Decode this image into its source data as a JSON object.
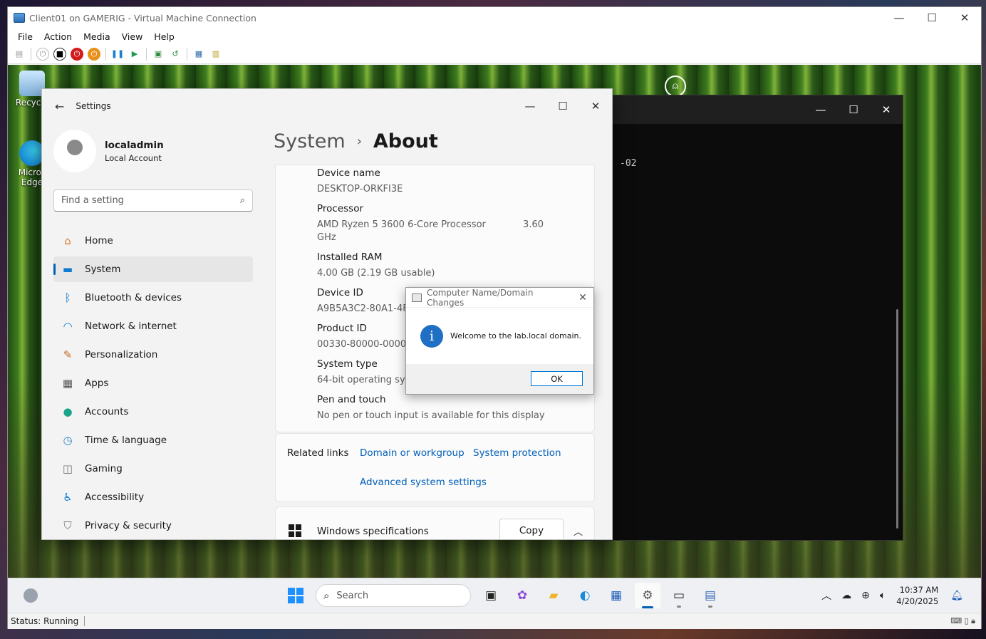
{
  "vm": {
    "title": "Client01 on GAMERIG - Virtual Machine Connection",
    "menu": [
      "File",
      "Action",
      "Media",
      "View",
      "Help"
    ],
    "status": "Status: Running"
  },
  "desktop": {
    "icons": [
      {
        "label": "Recycle",
        "label2": ""
      },
      {
        "label": "Micros",
        "label2": "Edge"
      }
    ]
  },
  "terminal": {
    "line": "-02"
  },
  "settings": {
    "title": "Settings",
    "user": {
      "name": "localadmin",
      "type": "Local Account"
    },
    "search_placeholder": "Find a setting",
    "nav": [
      {
        "label": "Home",
        "icon": "home-icon",
        "glyph": "⌂",
        "color": "#d9772b"
      },
      {
        "label": "System",
        "icon": "system-icon",
        "glyph": "▬",
        "color": "#0f7bd0",
        "active": true
      },
      {
        "label": "Bluetooth & devices",
        "icon": "bluetooth-icon",
        "glyph": "ᛒ",
        "color": "#0f7bd0"
      },
      {
        "label": "Network & internet",
        "icon": "wifi-icon",
        "glyph": "◠",
        "color": "#0f7bd0"
      },
      {
        "label": "Personalization",
        "icon": "brush-icon",
        "glyph": "✎",
        "color": "#c8692b"
      },
      {
        "label": "Apps",
        "icon": "apps-icon",
        "glyph": "▦",
        "color": "#555"
      },
      {
        "label": "Accounts",
        "icon": "accounts-icon",
        "glyph": "●",
        "color": "#1aa58a"
      },
      {
        "label": "Time & language",
        "icon": "clock-globe-icon",
        "glyph": "◷",
        "color": "#2a86c8"
      },
      {
        "label": "Gaming",
        "icon": "gamepad-icon",
        "glyph": "◫",
        "color": "#777"
      },
      {
        "label": "Accessibility",
        "icon": "accessibility-icon",
        "glyph": "♿",
        "color": "#0f7bd0"
      },
      {
        "label": "Privacy & security",
        "icon": "shield-icon",
        "glyph": "⛉",
        "color": "#777"
      }
    ],
    "breadcrumb": {
      "parent": "System",
      "separator": "›",
      "current": "About"
    },
    "specs": [
      {
        "label": "Device name",
        "value": "DESKTOP-ORKFI3E"
      },
      {
        "label": "Processor",
        "value": "AMD Ryzen 5 3600 6-Core Processor",
        "value_b": "3.60",
        "value_c": "GHz"
      },
      {
        "label": "Installed RAM",
        "value": "4.00 GB (2.19 GB usable)"
      },
      {
        "label": "Device ID",
        "value": "A9B5A3C2-80A1-4F6"
      },
      {
        "label": "Product ID",
        "value": "00330-80000-00000"
      },
      {
        "label": "System type",
        "value": "64-bit operating syst"
      },
      {
        "label": "Pen and touch",
        "value": "No pen or touch input is available for this display"
      }
    ],
    "related": {
      "label": "Related links",
      "links": [
        "Domain or workgroup",
        "System protection",
        "Advanced system settings"
      ]
    },
    "winspec": {
      "label": "Windows specifications",
      "copy": "Copy"
    }
  },
  "dialog": {
    "title": "Computer Name/Domain Changes",
    "message": "Welcome to the lab.local domain.",
    "ok": "OK"
  },
  "taskbar": {
    "search_placeholder": "Search",
    "time": "10:37 AM",
    "date": "4/20/2025"
  }
}
